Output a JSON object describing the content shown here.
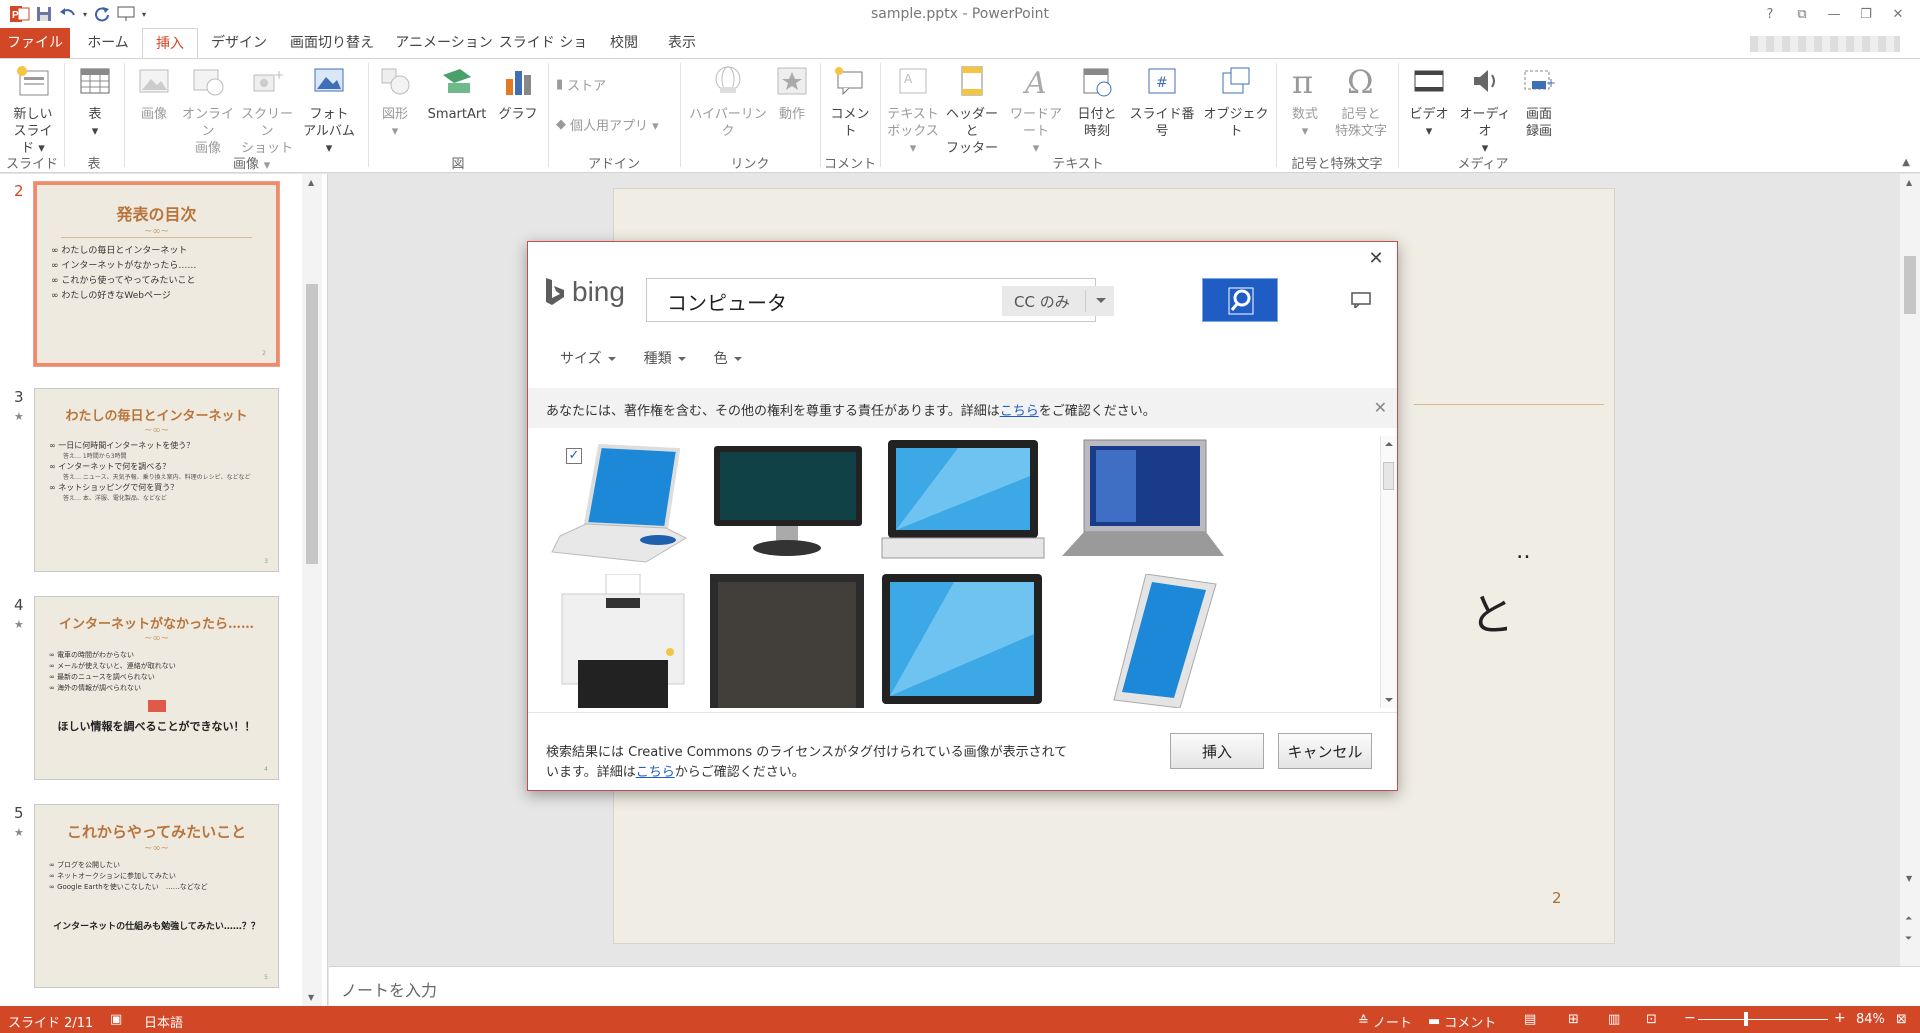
{
  "window": {
    "title": "sample.pptx - PowerPoint",
    "help": "?",
    "controls": [
      "⧉",
      "—",
      "❐",
      "✕"
    ]
  },
  "tabs": [
    "ファイル",
    "ホーム",
    "挿入",
    "デザイン",
    "画面切り替え",
    "アニメーション",
    "スライド ショー",
    "校閲",
    "表示"
  ],
  "ribbon": {
    "new_slide": [
      "新しい",
      "スライド ▾"
    ],
    "table": [
      "表",
      "▾"
    ],
    "image": "画像",
    "online_image": [
      "オンライン",
      "画像"
    ],
    "screenshot": [
      "スクリーン",
      "ショット ▾"
    ],
    "photo_album": [
      "フォト",
      "アルバム ▾"
    ],
    "shapes": [
      "図形",
      "▾"
    ],
    "smartart": "SmartArt",
    "graph": "グラフ",
    "store": "ストア",
    "my_apps": "個人用アプリ ▾",
    "hyperlink": "ハイパーリンク",
    "action": "動作",
    "comment": "コメント",
    "textbox": [
      "テキスト",
      "ボックス ▾"
    ],
    "header_footer": [
      "ヘッダーと",
      "フッター"
    ],
    "wordart": [
      "ワードアート",
      "▾"
    ],
    "datetime": [
      "日付と",
      "時刻"
    ],
    "slide_number": "スライド番号",
    "object": "オブジェクト",
    "equation": [
      "数式",
      "▾"
    ],
    "symbol": [
      "記号と",
      "特殊文字"
    ],
    "video": [
      "ビデオ",
      "▾"
    ],
    "audio": [
      "オーディオ",
      "▾"
    ],
    "screen_record": [
      "画面",
      "録画"
    ],
    "groups": {
      "slide": "スライド",
      "table": "表",
      "image": "画像",
      "figure": "図",
      "addin": "アドイン",
      "link": "リンク",
      "comment": "コメント",
      "text": "テキスト",
      "symbols": "記号と特殊文字",
      "media": "メディア"
    }
  },
  "slides": [
    {
      "num": "2",
      "title": "発表の目次",
      "lines": [
        "わたしの毎日とインターネット",
        "インターネットがなかったら……",
        "これから使ってやってみたいこと",
        "わたしの好きなWebページ"
      ],
      "page": "2"
    },
    {
      "num": "3",
      "title": "わたしの毎日とインターネット",
      "lines": [
        "一日に何時間インターネットを使う？",
        "インターネットで何を調べる？",
        "ネットショッピングで何を買う？"
      ],
      "subs": [
        "答え… 1時間から3時間",
        "答え… ニュース、天気予報、乗り換え案内、料理のレシピ、などなど",
        "答え… 本、洋服、電化製品、などなど"
      ],
      "page": "3"
    },
    {
      "num": "4",
      "title": "インターネットがなかったら……",
      "lines": [
        "電車の時間がわからない",
        "メールが使えないと、連絡が取れない",
        "最新のニュースを調べられない",
        "海外の情報が調べられない"
      ],
      "big": "ほしい情報を調べることができない！！",
      "page": "4"
    },
    {
      "num": "5",
      "title": "これからやってみたいこと",
      "lines": [
        "ブログを公開したい",
        "ネットオークションに参加してみたい",
        "Google Earthを使いこなしたい　……などなど"
      ],
      "big": "インターネットの仕組みも勉強してみたい……？？",
      "page": "5"
    }
  ],
  "star": "★",
  "slide_canvas": {
    "page_number": "2",
    "glyph": "と",
    "dots": "‥"
  },
  "notes_placeholder": "ノートを入力",
  "dialog": {
    "close": "✕",
    "brand": "bing",
    "search_value": "コンピュータ",
    "license_filter": "CC のみ",
    "filters": [
      "サイズ",
      "種類",
      "色"
    ],
    "notice_text": "あなたには、著作権を含む、その他の権利を尊重する責任があります。詳細は",
    "notice_link": "こちら",
    "notice_tail": "をご確認ください。",
    "footer_text1": "検索結果には Creative Commons のライセンスがタグ付けられている画像が表示されて",
    "footer_text2": "います。詳細は",
    "footer_link": "こちら",
    "footer_tail": "からご確認ください。",
    "insert_label": "挿入",
    "cancel_label": "キャンセル",
    "checkmark": "✓",
    "accent": "#1f5cc4"
  },
  "status": {
    "slide": "スライド 2/11",
    "language": "日本語",
    "notes": "ノート",
    "comments": "コメント",
    "zoom": "84%",
    "zoom_minus": "−",
    "zoom_plus": "+"
  },
  "colors": {
    "brand": "#d24726",
    "slide_title": "#b8743a"
  }
}
